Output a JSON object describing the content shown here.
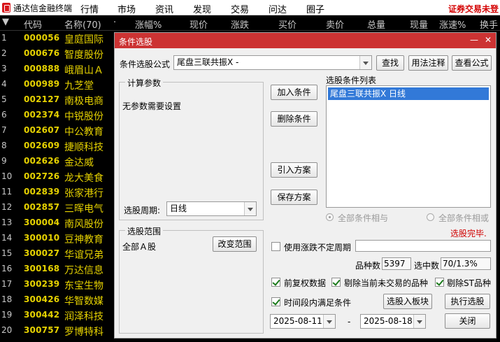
{
  "app": {
    "title": "通达信金融终端",
    "menu": [
      "行情",
      "市场",
      "资讯",
      "发现",
      "交易",
      "问达",
      "圈子"
    ],
    "right_note": "证券交易未登"
  },
  "table": {
    "columns": [
      "代码",
      "名称(70)",
      "·",
      "涨幅%",
      "现价",
      "涨跌",
      "买价",
      "卖价",
      "总量",
      "现量",
      "涨速%",
      "换手"
    ],
    "rows": [
      {
        "idx": "1",
        "code": "000056",
        "name": "皇庭国际"
      },
      {
        "idx": "2",
        "code": "000676",
        "name": "智度股份"
      },
      {
        "idx": "3",
        "code": "000888",
        "name": "峨眉山Ａ"
      },
      {
        "idx": "4",
        "code": "000989",
        "name": "九芝堂"
      },
      {
        "idx": "5",
        "code": "002127",
        "name": "南极电商"
      },
      {
        "idx": "6",
        "code": "002374",
        "name": "中锐股份"
      },
      {
        "idx": "7",
        "code": "002607",
        "name": "中公教育"
      },
      {
        "idx": "8",
        "code": "002609",
        "name": "捷顺科技"
      },
      {
        "idx": "9",
        "code": "002626",
        "name": "金达威"
      },
      {
        "idx": "10",
        "code": "002726",
        "name": "龙大美食"
      },
      {
        "idx": "11",
        "code": "002839",
        "name": "张家港行"
      },
      {
        "idx": "12",
        "code": "002857",
        "name": "三晖电气"
      },
      {
        "idx": "13",
        "code": "300004",
        "name": "南风股份"
      },
      {
        "idx": "14",
        "code": "300010",
        "name": "豆神教育"
      },
      {
        "idx": "15",
        "code": "300027",
        "name": "华谊兄弟"
      },
      {
        "idx": "16",
        "code": "300168",
        "name": "万达信息"
      },
      {
        "idx": "17",
        "code": "300239",
        "name": "东宝生物"
      },
      {
        "idx": "18",
        "code": "300426",
        "name": "华智数媒"
      },
      {
        "idx": "19",
        "code": "300442",
        "name": "润泽科技"
      },
      {
        "idx": "20",
        "code": "300757",
        "name": "罗博特科"
      }
    ]
  },
  "dialog": {
    "title": "条件选股",
    "minimize": "—",
    "close": "✕",
    "formula_label": "条件选股公式",
    "formula_value": "尾盘三联共振X -",
    "find_btn": "查找",
    "usage_btn": "用法注释",
    "view_btn": "查看公式",
    "params_title": "计算参数",
    "params_text": "无参数需要设置",
    "period_label": "选股周期:",
    "period_value": "日线",
    "add_btn": "加入条件",
    "delete_btn": "删除条件",
    "import_btn": "引入方案",
    "save_btn": "保存方案",
    "cond_list_title": "选股条件列表",
    "cond_item": "尾盘三联共振X  日线",
    "radio_and": "全部条件相与",
    "radio_or": "全部条件相或",
    "status": "选股完毕.",
    "scope_title": "选股范围",
    "scope_value": "全部Ａ股",
    "change_scope_btn": "改变范围",
    "use_period_label": "使用涨跌不定周期",
    "count_label": "品种数",
    "count_value": "5397",
    "hit_label": "选中数",
    "hit_value": "70/1.3%",
    "fq_label": "前复权数据",
    "exclude_untraded_label": "剔除当前未交易的品种",
    "exclude_st_label": "剔除ST品种",
    "time_range_label": "时间段内满足条件",
    "to_board_btn": "选股入板块",
    "run_btn": "执行选股",
    "date_start": "2025-08-11",
    "date_sep": "-",
    "date_end": "2025-08-18",
    "close_btn": "关闭"
  }
}
